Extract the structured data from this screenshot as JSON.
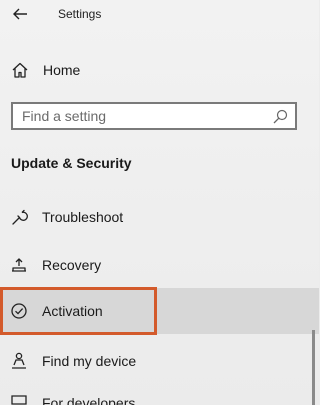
{
  "window": {
    "title": "Settings"
  },
  "nav": {
    "home_label": "Home"
  },
  "search": {
    "placeholder": "Find a setting"
  },
  "section": {
    "title": "Update & Security"
  },
  "items": [
    {
      "label": "Troubleshoot",
      "icon": "wrench-icon"
    },
    {
      "label": "Recovery",
      "icon": "recovery-icon"
    },
    {
      "label": "Activation",
      "icon": "check-circle-icon",
      "selected": true
    },
    {
      "label": "Find my device",
      "icon": "person-pin-icon"
    },
    {
      "label": "For developers",
      "icon": "developer-icon"
    }
  ],
  "colors": {
    "highlight": "#d35a2b",
    "selected_bg": "#d7d7d7"
  }
}
